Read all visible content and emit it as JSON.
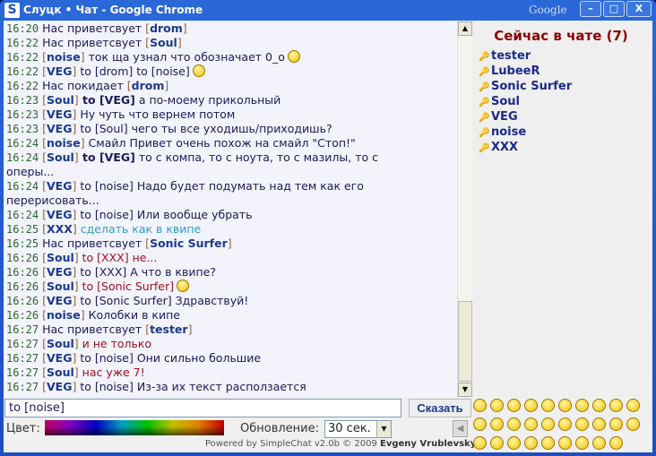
{
  "window": {
    "title": "Слуцк • Чат - Google Chrome",
    "logo": "S",
    "brand": "Google",
    "minimize": "–",
    "maximize": "□",
    "close": "X"
  },
  "messages": [
    {
      "time": "16:20",
      "parts": [
        {
          "t": "Нас приветсвует "
        },
        {
          "t": "[",
          "c": "br"
        },
        {
          "t": "drom",
          "c": "nk"
        },
        {
          "t": "]",
          "c": "br"
        }
      ]
    },
    {
      "time": "16:22",
      "parts": [
        {
          "t": "Нас приветсвует "
        },
        {
          "t": "[",
          "c": "br"
        },
        {
          "t": "Soul",
          "c": "nk"
        },
        {
          "t": "]",
          "c": "br"
        }
      ]
    },
    {
      "time": "16:22",
      "parts": [
        {
          "t": "[",
          "c": "br"
        },
        {
          "t": "noise",
          "c": "nk"
        },
        {
          "t": "]",
          "c": "br"
        },
        {
          "t": " ток ща узнал что обозначает 0_o"
        }
      ],
      "smiley": "grin"
    },
    {
      "time": "16:22",
      "parts": [
        {
          "t": "[",
          "c": "br"
        },
        {
          "t": "VEG",
          "c": "nk"
        },
        {
          "t": "]",
          "c": "br"
        },
        {
          "t": " to [drom] to [noise]"
        }
      ],
      "smiley": "wave"
    },
    {
      "time": "16:22",
      "parts": [
        {
          "t": "Нас покидает "
        },
        {
          "t": "[",
          "c": "br"
        },
        {
          "t": "drom",
          "c": "nk"
        },
        {
          "t": "]",
          "c": "br"
        }
      ]
    },
    {
      "time": "16:23",
      "parts": [
        {
          "t": "[",
          "c": "br"
        },
        {
          "t": "Soul",
          "c": "nk"
        },
        {
          "t": "]",
          "c": "br"
        },
        {
          "t": " to [VEG]",
          "c": "bold"
        },
        {
          "t": " а по-моему прикольный"
        }
      ]
    },
    {
      "time": "16:23",
      "parts": [
        {
          "t": "[",
          "c": "br"
        },
        {
          "t": "VEG",
          "c": "nk"
        },
        {
          "t": "]",
          "c": "br"
        },
        {
          "t": " Ну чуть что вернем потом"
        }
      ]
    },
    {
      "time": "16:23",
      "parts": [
        {
          "t": "[",
          "c": "br"
        },
        {
          "t": "VEG",
          "c": "nk"
        },
        {
          "t": "]",
          "c": "br"
        },
        {
          "t": " to [Soul] чего ты все уходишь/приходишь?"
        }
      ]
    },
    {
      "time": "16:24",
      "parts": [
        {
          "t": "[",
          "c": "br"
        },
        {
          "t": "noise",
          "c": "nk"
        },
        {
          "t": "]",
          "c": "br"
        },
        {
          "t": " Смайл Привет очень похож на смайл \"Стоп!\""
        }
      ]
    },
    {
      "time": "16:24",
      "parts": [
        {
          "t": "[",
          "c": "br"
        },
        {
          "t": "Soul",
          "c": "nk"
        },
        {
          "t": "]",
          "c": "br"
        },
        {
          "t": " to [VEG]",
          "c": "bold"
        },
        {
          "t": " то с компа, то с ноута, то с мазилы, то с оперы..."
        }
      ]
    },
    {
      "time": "16:24",
      "parts": [
        {
          "t": "[",
          "c": "br"
        },
        {
          "t": "VEG",
          "c": "nk"
        },
        {
          "t": "]",
          "c": "br"
        },
        {
          "t": " to [noise] Надо будет подумать над тем как его перерисовать..."
        }
      ]
    },
    {
      "time": "16:24",
      "parts": [
        {
          "t": "[",
          "c": "br"
        },
        {
          "t": "VEG",
          "c": "nk"
        },
        {
          "t": "]",
          "c": "br"
        },
        {
          "t": " to [noise] Или вообще убрать"
        }
      ]
    },
    {
      "time": "16:25",
      "parts": [
        {
          "t": "[",
          "c": "br"
        },
        {
          "t": "XXX",
          "c": "nk"
        },
        {
          "t": "]",
          "c": "br"
        },
        {
          "t": " сделать как в квипе",
          "c": "cyan"
        }
      ]
    },
    {
      "time": "16:25",
      "parts": [
        {
          "t": "Нас приветсвует "
        },
        {
          "t": "[",
          "c": "br"
        },
        {
          "t": "Sonic Surfer",
          "c": "nk"
        },
        {
          "t": "]",
          "c": "br"
        }
      ]
    },
    {
      "time": "16:26",
      "parts": [
        {
          "t": "[",
          "c": "br"
        },
        {
          "t": "Soul",
          "c": "nk"
        },
        {
          "t": "]",
          "c": "br"
        },
        {
          "t": " to [XXX] не...",
          "c": "red"
        }
      ]
    },
    {
      "time": "16:26",
      "parts": [
        {
          "t": "[",
          "c": "br"
        },
        {
          "t": "VEG",
          "c": "nk"
        },
        {
          "t": "]",
          "c": "br"
        },
        {
          "t": " to [XXX] А что в квипе?"
        }
      ]
    },
    {
      "time": "16:26",
      "parts": [
        {
          "t": "[",
          "c": "br"
        },
        {
          "t": "Soul",
          "c": "nk"
        },
        {
          "t": "]",
          "c": "br"
        },
        {
          "t": " to [Sonic Surfer]",
          "c": "red"
        }
      ],
      "smiley": "smile"
    },
    {
      "time": "16:26",
      "parts": [
        {
          "t": "[",
          "c": "br"
        },
        {
          "t": "VEG",
          "c": "nk"
        },
        {
          "t": "]",
          "c": "br"
        },
        {
          "t": " to [Sonic Surfer] Здравствуй!"
        }
      ]
    },
    {
      "time": "16:26",
      "parts": [
        {
          "t": "[",
          "c": "br"
        },
        {
          "t": "noise",
          "c": "nk"
        },
        {
          "t": "]",
          "c": "br"
        },
        {
          "t": " Колобки в кипе"
        }
      ]
    },
    {
      "time": "16:27",
      "parts": [
        {
          "t": "Нас приветсвует "
        },
        {
          "t": "[",
          "c": "br"
        },
        {
          "t": "tester",
          "c": "nk"
        },
        {
          "t": "]",
          "c": "br"
        }
      ]
    },
    {
      "time": "16:27",
      "parts": [
        {
          "t": "[",
          "c": "br"
        },
        {
          "t": "Soul",
          "c": "nk"
        },
        {
          "t": "]",
          "c": "br"
        },
        {
          "t": " и не только",
          "c": "red"
        }
      ]
    },
    {
      "time": "16:27",
      "parts": [
        {
          "t": "[",
          "c": "br"
        },
        {
          "t": "VEG",
          "c": "nk"
        },
        {
          "t": "]",
          "c": "br"
        },
        {
          "t": " to [noise] Они сильно большие"
        }
      ]
    },
    {
      "time": "16:27",
      "parts": [
        {
          "t": "[",
          "c": "br"
        },
        {
          "t": "Soul",
          "c": "nk"
        },
        {
          "t": "]",
          "c": "br"
        },
        {
          "t": " нас уже 7!",
          "c": "red"
        }
      ]
    },
    {
      "time": "16:27",
      "parts": [
        {
          "t": "[",
          "c": "br"
        },
        {
          "t": "VEG",
          "c": "nk"
        },
        {
          "t": "]",
          "c": "br"
        },
        {
          "t": " to [noise] Из-за их текст расползается"
        }
      ]
    }
  ],
  "users": {
    "heading": "Сейчас в чате (7)",
    "list": [
      "tester",
      "LubeeR",
      "Sonic Surfer",
      "Soul",
      "VEG",
      "noise",
      "XXX"
    ]
  },
  "composer": {
    "input_value": "to [noise]",
    "send_label": "Сказать",
    "color_label": "Цвет:",
    "refresh_label": "Обновление:",
    "refresh_value": "30 сек.",
    "powered": "Powered by SimpleChat v2.0b © 2009",
    "author": "Evgeny Vrublevsky"
  },
  "emoticons": [
    "wave",
    "smile",
    "wink",
    "devil",
    "sad",
    "angry",
    "thinking",
    "shocked",
    "surprised",
    "confused",
    "laugh",
    "happy",
    "blush",
    "help",
    "cool",
    "cry",
    "grin",
    "yell",
    "nerd",
    "worried",
    "scared",
    "pray",
    "facepalm",
    "sly",
    "eye",
    "cap",
    "bandana",
    "dizzy",
    "moan",
    "",
    "",
    ""
  ]
}
